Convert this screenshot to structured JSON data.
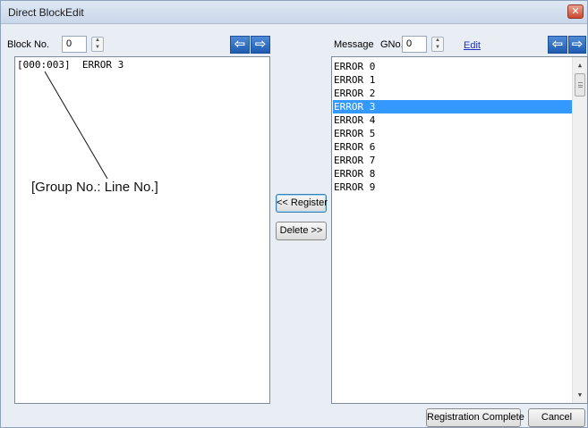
{
  "window": {
    "title": "Direct BlockEdit",
    "close_glyph": "✕"
  },
  "block_panel": {
    "block_no_label": "Block No.",
    "block_no_value": "0",
    "entries": [
      "[000:003]  ERROR 3"
    ],
    "annotation": "[Group No.: Line No.]"
  },
  "middle": {
    "register_label": "<< Register",
    "delete_label": "Delete >>"
  },
  "message_panel": {
    "message_label": "Message",
    "gno_label": "GNo.",
    "gno_value": "0",
    "edit_link": "Edit",
    "messages": [
      "ERROR 0",
      "ERROR 1",
      "ERROR 2",
      "ERROR 3",
      "ERROR 4",
      "ERROR 5",
      "ERROR 6",
      "ERROR 7",
      "ERROR 8",
      "ERROR 9"
    ],
    "selected_index": 3
  },
  "footer": {
    "registration_complete_label": "Registration Complete",
    "cancel_label": "Cancel"
  },
  "icons": {
    "prev": "arrow-left-icon",
    "next": "arrow-right-icon",
    "spin_up": "spin-up-icon",
    "spin_down": "spin-down-icon",
    "scroll_up": "scroll-up-icon",
    "scroll_down": "scroll-down-icon"
  },
  "colors": {
    "selection": "#3399ff",
    "nav_arrow": "#2f6cc4",
    "link": "#1d2fbd"
  }
}
